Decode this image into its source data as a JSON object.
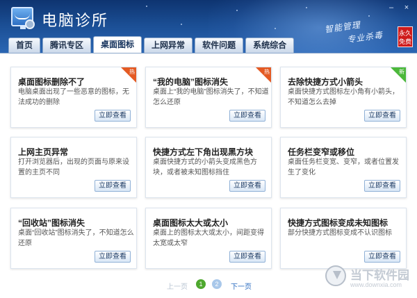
{
  "header": {
    "app_title": "电脑诊所",
    "slogan_line1": "智能管理",
    "slogan_line2": "专业杀毒",
    "free_badge": "永久免费",
    "minimize": "–",
    "close": "×"
  },
  "tabs": [
    {
      "label": "首页"
    },
    {
      "label": "腾讯专区"
    },
    {
      "label": "桌面图标"
    },
    {
      "label": "上网异常"
    },
    {
      "label": "软件问题"
    },
    {
      "label": "系统综合"
    }
  ],
  "cards": [
    {
      "title": "桌面图标删除不了",
      "desc": "电脑桌面出现了一些恶意的图标，无法成功的删除",
      "button": "立即查看",
      "badge": "热",
      "badge_color": "#e45a23"
    },
    {
      "title": "“我的电脑”图标消失",
      "desc": "桌面上“我的电脑”图标消失了，不知道怎么还原",
      "button": "立即查看",
      "badge": "热",
      "badge_color": "#e45a23"
    },
    {
      "title": "去除快捷方式小箭头",
      "desc": "桌面快捷方式图标左小角有小箭头，不知道怎么去掉",
      "button": "立即查看",
      "badge": "新",
      "badge_color": "#4bb83a"
    },
    {
      "title": "上网主页异常",
      "desc": "打开浏览器后，出现的页面与原来设置的主页不同",
      "button": "立即查看"
    },
    {
      "title": "快捷方式左下角出现黑方块",
      "desc": "桌面快捷方式的小箭头变成黑色方块，或者被未知图标挡住",
      "button": "立即查看"
    },
    {
      "title": "任务栏变窄或移位",
      "desc": "桌面任务栏变宽、变窄，或者位置发生了变化",
      "button": "立即查看"
    },
    {
      "title": "“回收站”图标消失",
      "desc": "桌面“回收站”图标消失了，不知道怎么还原",
      "button": "立即查看"
    },
    {
      "title": "桌面图标太大或太小",
      "desc": "桌面上的图标太大或太小，间距变得太宽或太窄",
      "button": "立即查看"
    },
    {
      "title": "快捷方式图标变成未知图标",
      "desc": "部分快捷方式图标变成不认识图标",
      "button": "立即查看"
    }
  ],
  "pager": {
    "prev": "上一页",
    "page1": "1",
    "page2": "2",
    "next": "下一页"
  },
  "watermark": {
    "main": "当下软件园",
    "sub": "www.downxia.com"
  }
}
